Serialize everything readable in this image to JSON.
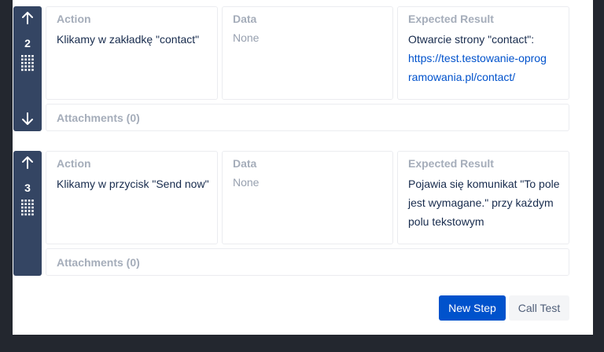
{
  "steps": [
    {
      "number": "2",
      "action_label": "Action",
      "action_value": "Klikamy w zakładkę \"contact\"",
      "data_label": "Data",
      "data_value": "None",
      "expected_label": "Expected Result",
      "expected_text": "Otwarcie strony \"contact\":",
      "expected_link": "https://test.testowanie-oprogramowania.pl/contact/",
      "attachments": "Attachments (0)"
    },
    {
      "number": "3",
      "action_label": "Action",
      "action_value": "Klikamy w przycisk \"Send now\"",
      "data_label": "Data",
      "data_value": "None",
      "expected_label": "Expected Result",
      "expected_text": "Pojawia się komunikat \"To pole jest wymagane.\" przy każdym polu tekstowym",
      "attachments": "Attachments (0)"
    }
  ],
  "buttons": {
    "new_step": "New Step",
    "call_test": "Call Test"
  },
  "colors": {
    "handle": "#344563",
    "primary": "#0052cc",
    "link": "#0052cc",
    "background": "#23272f"
  },
  "icons": {
    "move_up": "arrow-up-icon",
    "move_down": "arrow-down-icon",
    "drag": "drag-grip-icon"
  }
}
